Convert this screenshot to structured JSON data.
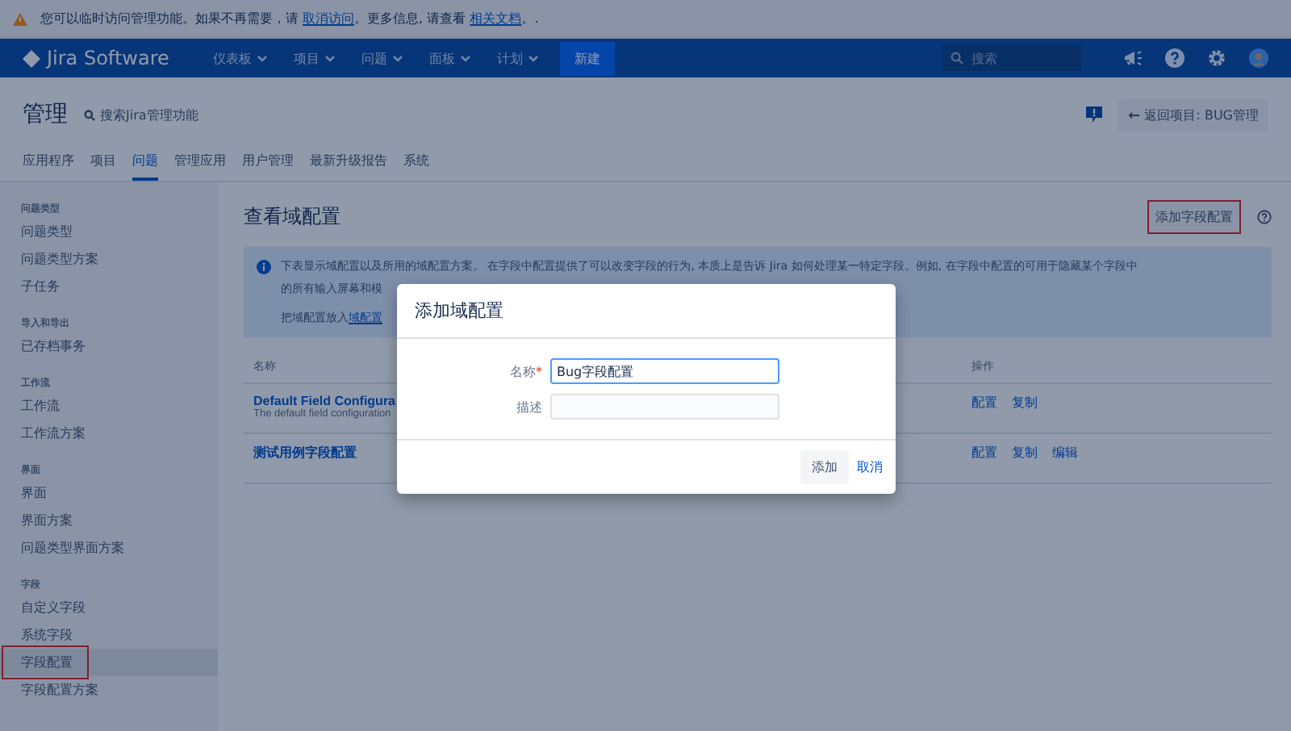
{
  "banner": {
    "parts": [
      {
        "kind": "text",
        "text": "您可以临时访问管理功能。如果不再需要，请 "
      },
      {
        "kind": "link",
        "text": "取消访问"
      },
      {
        "kind": "text",
        "text": "。更多信息, 请查看 "
      },
      {
        "kind": "link",
        "text": "相关文档"
      },
      {
        "kind": "text",
        "text": "。."
      }
    ]
  },
  "nav": {
    "product": "Jira Software",
    "menus": [
      "仪表板",
      "项目",
      "问题",
      "面板",
      "计划"
    ],
    "create": "新建",
    "search": {
      "placeholder": "搜索"
    }
  },
  "header": {
    "title": "管理",
    "search": {
      "placeholder": "搜索Jira管理功能"
    },
    "back": "返回项目: BUG管理",
    "tabs": [
      {
        "label": "应用程序",
        "selected": false
      },
      {
        "label": "项目",
        "selected": false
      },
      {
        "label": "问题",
        "selected": true
      },
      {
        "label": "管理应用",
        "selected": false
      },
      {
        "label": "用户管理",
        "selected": false
      },
      {
        "label": "最新升级报告",
        "selected": false
      },
      {
        "label": "系统",
        "selected": false
      }
    ]
  },
  "sidebar": [
    {
      "heading": "问题类型",
      "items": [
        {
          "label": "问题类型",
          "selected": false,
          "highlighted": false
        },
        {
          "label": "问题类型方案",
          "selected": false,
          "highlighted": false
        },
        {
          "label": "子任务",
          "selected": false,
          "highlighted": false
        }
      ]
    },
    {
      "heading": "导入和导出",
      "items": [
        {
          "label": "已存档事务",
          "selected": false,
          "highlighted": false
        }
      ]
    },
    {
      "heading": "工作流",
      "items": [
        {
          "label": "工作流",
          "selected": false,
          "highlighted": false
        },
        {
          "label": "工作流方案",
          "selected": false,
          "highlighted": false
        }
      ]
    },
    {
      "heading": "界面",
      "items": [
        {
          "label": "界面",
          "selected": false,
          "highlighted": false
        },
        {
          "label": "界面方案",
          "selected": false,
          "highlighted": false
        },
        {
          "label": "问题类型界面方案",
          "selected": false,
          "highlighted": false
        }
      ]
    },
    {
      "heading": "字段",
      "items": [
        {
          "label": "自定义字段",
          "selected": false,
          "highlighted": false
        },
        {
          "label": "系统字段",
          "selected": false,
          "highlighted": false
        },
        {
          "label": "字段配置",
          "selected": true,
          "highlighted": true
        },
        {
          "label": "字段配置方案",
          "selected": false,
          "highlighted": false
        }
      ]
    }
  ],
  "main": {
    "title": "查看域配置",
    "add_button": {
      "label": "添加字段配置",
      "highlighted": true
    },
    "info": {
      "line1": "下表显示域配置以及所用的域配置方案。 在字段中配置提供了可以改变字段的行为, 本质上是告诉 Jira 如何处理某一特定字段。例如, 在字段中配置的可用于隐藏某个字段中",
      "line2": "的所有输入屏幕和模",
      "line3_text": "把域配置放入",
      "line3_link": "域配置"
    },
    "table": {
      "columns": [
        "名称",
        "操作"
      ],
      "rows": [
        {
          "name": "Default Field Configura",
          "description": "The default field configuration",
          "actions": [
            "配置",
            "复制"
          ]
        },
        {
          "name": "测试用例字段配置",
          "actions": [
            "配置",
            "复制",
            "编辑"
          ]
        }
      ]
    }
  },
  "dialog": {
    "title": "添加域配置",
    "fields": [
      {
        "label": "名称",
        "required_mark": "*",
        "value": "Bug字段配置",
        "focused": true
      },
      {
        "label": "描述",
        "focused": false
      }
    ],
    "submit": "添加",
    "cancel": "取消"
  }
}
